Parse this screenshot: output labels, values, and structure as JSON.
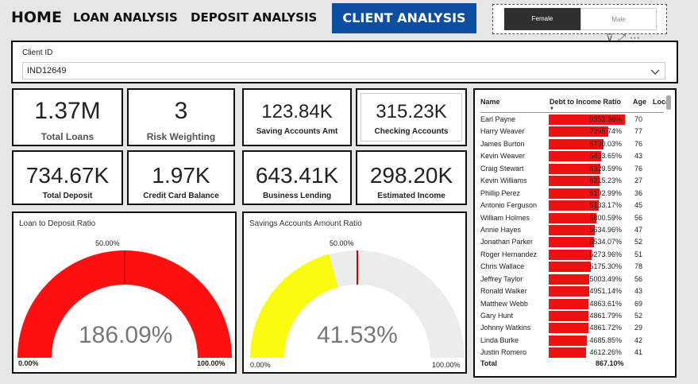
{
  "nav": {
    "home": "HOME",
    "loan": "LOAN ANALYSIS",
    "deposit": "DEPOSIT ANALYSIS",
    "client": "CLIENT ANALYSIS"
  },
  "gender_slicer": {
    "options": [
      "Female",
      "Male"
    ],
    "selected": "Female"
  },
  "client_filter": {
    "label": "Client ID",
    "value": "IND12649"
  },
  "kpis": {
    "total_loans": {
      "value": "1.37M",
      "label": "Total Loans"
    },
    "risk_weighting": {
      "value": "3",
      "label": "Risk Weighting"
    },
    "saving_accounts": {
      "value": "123.84K",
      "label": "Saving Accounts Amt"
    },
    "checking_accounts": {
      "value": "315.23K",
      "label": "Checking Accounts"
    },
    "total_deposit": {
      "value": "734.67K",
      "label": "Total Deposit"
    },
    "credit_card": {
      "value": "1.97K",
      "label": "Credit Card Balance"
    },
    "business_lending": {
      "value": "643.41K",
      "label": "Business Lending"
    },
    "estimated_income": {
      "value": "298.20K",
      "label": "Estimated Income"
    }
  },
  "gauges": {
    "loan_deposit": {
      "title": "Loan to Deposit Ratio",
      "value": "186.09%",
      "fraction": 1.0,
      "min": "0.00%",
      "max": "100.00%",
      "target": "50.00%",
      "color": "#ff1010"
    },
    "savings": {
      "title": "Savings Accounts Amount Ratio",
      "value": "41.53%",
      "fraction": 0.4153,
      "min": "0.00%",
      "max": "100.00%",
      "target": "50.00%",
      "color": "#fbfb10"
    }
  },
  "table": {
    "headers": {
      "name": "Name",
      "ratio": "Debt to Income Ratio",
      "age": "Age",
      "loc": "Loca"
    },
    "rows": [
      {
        "name": "Earl Payne",
        "ratio": "9352.36%",
        "value": 9352.36,
        "age": "70"
      },
      {
        "name": "Harry Weaver",
        "ratio": "7295.74%",
        "value": 7295.74,
        "age": "77"
      },
      {
        "name": "James Burton",
        "ratio": "6720.03%",
        "value": 6720.03,
        "age": "76"
      },
      {
        "name": "Kevin Weaver",
        "ratio": "6463.65%",
        "value": 6463.65,
        "age": "43"
      },
      {
        "name": "Craig Stewart",
        "ratio": "6329.59%",
        "value": 6329.59,
        "age": "76"
      },
      {
        "name": "Kevin Williams",
        "ratio": "6215.23%",
        "value": 6215.23,
        "age": "27"
      },
      {
        "name": "Phillip Perez",
        "ratio": "6192.99%",
        "value": 6192.99,
        "age": "36"
      },
      {
        "name": "Antonio Ferguson",
        "ratio": "6133.17%",
        "value": 6133.17,
        "age": "45"
      },
      {
        "name": "William Holmes",
        "ratio": "5800.59%",
        "value": 5800.59,
        "age": "56"
      },
      {
        "name": "Annie Hayes",
        "ratio": "5634.96%",
        "value": 5634.96,
        "age": "47"
      },
      {
        "name": "Jonathan Parker",
        "ratio": "5534.07%",
        "value": 5534.07,
        "age": "52"
      },
      {
        "name": "Roger Hernandez",
        "ratio": "5273.96%",
        "value": 5273.96,
        "age": "51"
      },
      {
        "name": "Chris Wallace",
        "ratio": "5175.30%",
        "value": 5175.3,
        "age": "78"
      },
      {
        "name": "Jeffrey Taylor",
        "ratio": "5003.49%",
        "value": 5003.49,
        "age": "56"
      },
      {
        "name": "Ronald Walker",
        "ratio": "4951.14%",
        "value": 4951.14,
        "age": "43"
      },
      {
        "name": "Matthew Webb",
        "ratio": "4863.61%",
        "value": 4863.61,
        "age": "69"
      },
      {
        "name": "Gary Hunt",
        "ratio": "4861.79%",
        "value": 4861.79,
        "age": "52"
      },
      {
        "name": "Johnny Watkins",
        "ratio": "4861.72%",
        "value": 4861.72,
        "age": "29"
      },
      {
        "name": "Linda Burke",
        "ratio": "4685.85%",
        "value": 4685.85,
        "age": "42"
      },
      {
        "name": "Justin Romero",
        "ratio": "4612.26%",
        "value": 4612.26,
        "age": "41"
      }
    ],
    "total_label": "Total",
    "total_value": "867.10%"
  },
  "icons": [
    "filter-icon",
    "focus-mode-icon",
    "more-options-icon",
    "chevron-down-icon",
    "sort-descending-icon"
  ],
  "colors": {
    "accent": "#0b4ea2",
    "bar": "#e11111",
    "gauge_red": "#ff1010",
    "gauge_yellow": "#fbfb10"
  }
}
